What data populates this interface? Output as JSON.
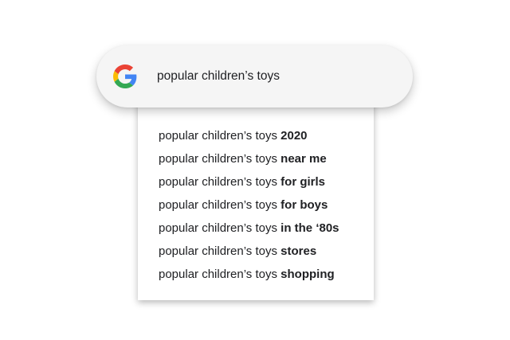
{
  "search": {
    "query": "popular children’s toys",
    "logo_icon": "google-g-icon",
    "brand_colors": {
      "blue": "#4285F4",
      "red": "#EA4335",
      "yellow": "#FBBC05",
      "green": "#34A853"
    }
  },
  "suggestions": [
    {
      "prefix": "popular children’s toys ",
      "completion": "2020"
    },
    {
      "prefix": "popular children’s toys ",
      "completion": "near me"
    },
    {
      "prefix": "popular children’s toys ",
      "completion": "for girls"
    },
    {
      "prefix": "popular children’s toys ",
      "completion": "for boys"
    },
    {
      "prefix": "popular children’s toys ",
      "completion": "in the ‘80s"
    },
    {
      "prefix": "popular children’s toys ",
      "completion": "stores"
    },
    {
      "prefix": "popular children’s toys ",
      "completion": "shopping"
    }
  ]
}
